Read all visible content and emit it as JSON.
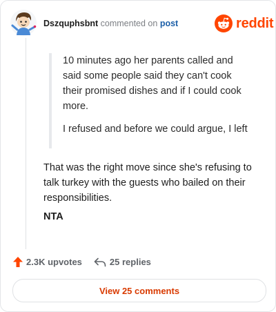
{
  "header": {
    "username": "Dszquphsbnt",
    "action_text": "commented on",
    "post_link": "post",
    "brand": "reddit"
  },
  "quote": {
    "paragraphs": [
      "10 minutes ago her parents called and said some people said they can't cook their promised dishes and if I could cook more.",
      "I refused and before we could argue, I left"
    ]
  },
  "comment": {
    "body": "That was the right move since she's refusing to talk turkey with the guests who bailed on their responsibilities.",
    "verdict": "NTA"
  },
  "stats": {
    "upvotes": "2.3K upvotes",
    "replies": "25 replies"
  },
  "view_comments_label": "View 25 comments",
  "colors": {
    "brand": "#ff4500",
    "link": "#1c5fa8",
    "action": "#d93a00"
  },
  "icons": [
    "avatar",
    "reddit-logo-icon",
    "upvote-arrow-icon",
    "reply-arrow-icon"
  ]
}
